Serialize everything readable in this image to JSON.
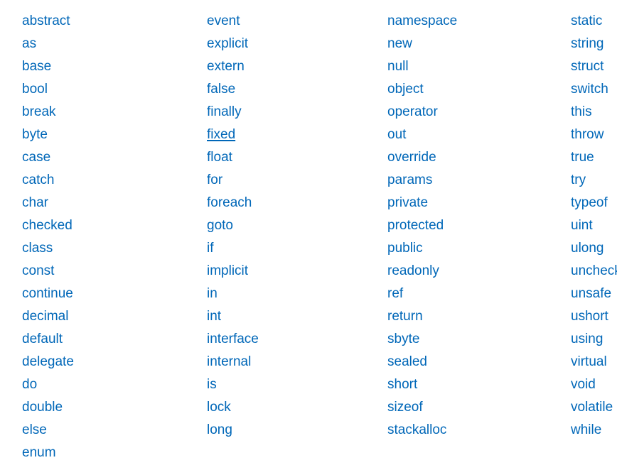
{
  "page": {
    "background_color": "#ffffff",
    "link_color": "#0067b8",
    "hovered_keyword": "fixed"
  },
  "keyword_table": {
    "columns": [
      {
        "name": "column-1",
        "keywords": [
          "abstract",
          "as",
          "base",
          "bool",
          "break",
          "byte",
          "case",
          "catch",
          "char",
          "checked",
          "class",
          "const",
          "continue",
          "decimal",
          "default",
          "delegate",
          "do",
          "double",
          "else",
          "enum"
        ]
      },
      {
        "name": "column-2",
        "keywords": [
          "event",
          "explicit",
          "extern",
          "false",
          "finally",
          "fixed",
          "float",
          "for",
          "foreach",
          "goto",
          "if",
          "implicit",
          "in",
          "int",
          "interface",
          "internal",
          "is",
          "lock",
          "long"
        ]
      },
      {
        "name": "column-3",
        "keywords": [
          "namespace",
          "new",
          "null",
          "object",
          "operator",
          "out",
          "override",
          "params",
          "private",
          "protected",
          "public",
          "readonly",
          "ref",
          "return",
          "sbyte",
          "sealed",
          "short",
          "sizeof",
          "stackalloc"
        ]
      },
      {
        "name": "column-4",
        "keywords": [
          "static",
          "string",
          "struct",
          "switch",
          "this",
          "throw",
          "true",
          "try",
          "typeof",
          "uint",
          "ulong",
          "unchecked",
          "unsafe",
          "ushort",
          "using",
          "virtual",
          "void",
          "volatile",
          "while"
        ]
      }
    ]
  }
}
